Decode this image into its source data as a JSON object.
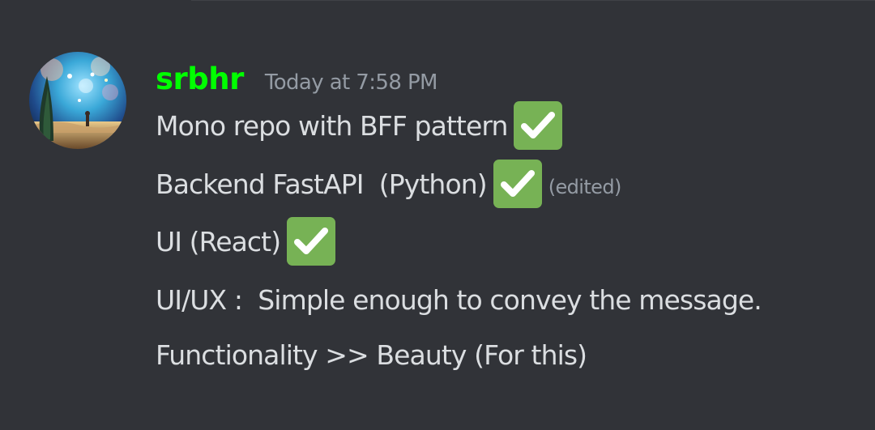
{
  "theme": {
    "background": "#313338",
    "username_color": "#00ff00",
    "muted_text_color": "#949ba4",
    "check_bg": "#77b255"
  },
  "message": {
    "author": "srbhr",
    "timestamp": "Today at 7:58 PM",
    "avatar_icon": "starry-night-avatar",
    "edited_label": "(edited)",
    "lines": [
      {
        "text": "Mono repo with BFF pattern",
        "emoji": "white-check-mark"
      },
      {
        "text": "Backend FastAPI  (Python)",
        "emoji": "white-check-mark"
      },
      {
        "text": "UI (React)",
        "emoji": "white-check-mark"
      },
      {
        "text": "UI/UX :  Simple enough to convey the message."
      },
      {
        "text": "Functionality >> Beauty (For this)"
      }
    ]
  }
}
